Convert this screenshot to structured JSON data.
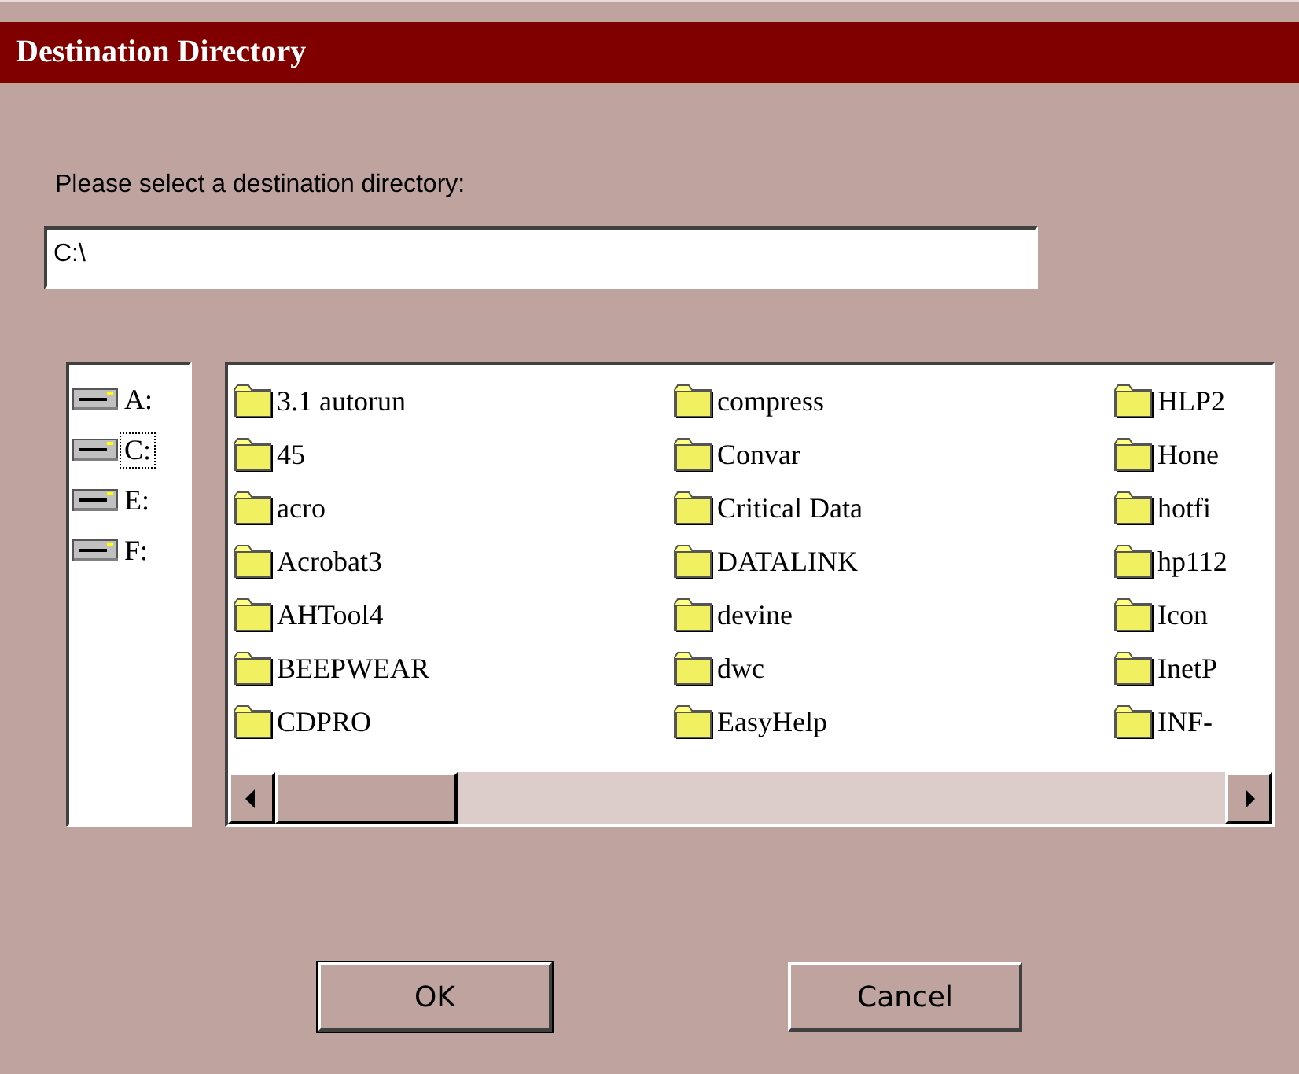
{
  "window": {
    "title": "Destination Directory"
  },
  "prompt": "Please select a destination directory:",
  "path_field": {
    "value": "C:\\"
  },
  "drives": [
    {
      "label": "A:",
      "selected": false
    },
    {
      "label": "C:",
      "selected": true
    },
    {
      "label": "E:",
      "selected": false
    },
    {
      "label": "F:",
      "selected": false
    }
  ],
  "folder_columns": [
    [
      "3.1 autorun",
      "45",
      "acro",
      "Acrobat3",
      "AHTool4",
      "BEEPWEAR",
      "CDPRO"
    ],
    [
      "compress",
      "Convar",
      "Critical Data",
      "DATALINK",
      "devine",
      "dwc",
      "EasyHelp"
    ],
    [
      "HLP2",
      "Hone",
      "hotfi",
      "hp112",
      "Icon",
      "InetP",
      "INF-"
    ]
  ],
  "buttons": [
    {
      "label": "OK",
      "default": true
    },
    {
      "label": "Cancel",
      "default": false
    }
  ]
}
